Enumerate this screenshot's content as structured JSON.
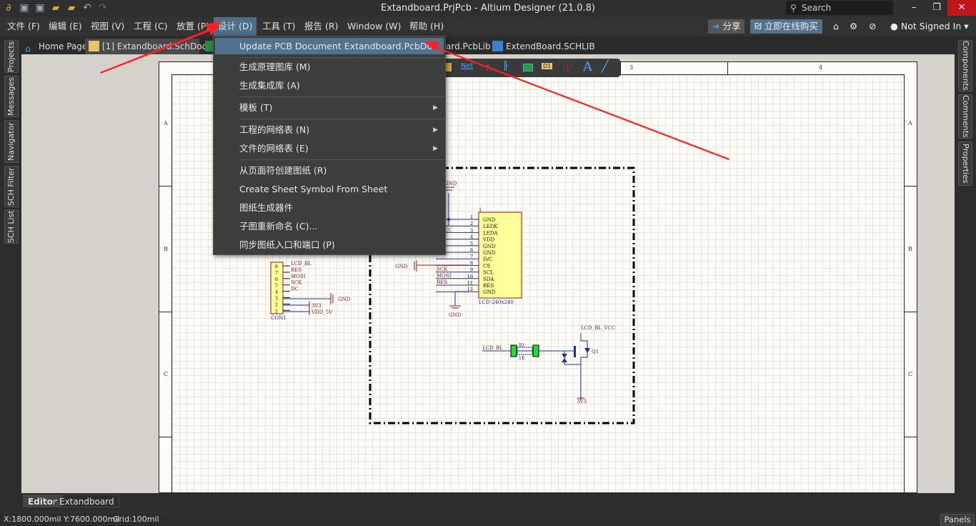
{
  "window": {
    "title": "Extandboard.PrjPcb - Altium Designer (21.0.8)",
    "search_placeholder": "Search",
    "minimize": "–",
    "restore": "❐",
    "close": "✕"
  },
  "menubar": {
    "items": [
      "文件 (F)",
      "编辑 (E)",
      "视图 (V)",
      "工程 (C)",
      "放置 (P)",
      "设计 (D)",
      "工具 (T)",
      "报告 (R)",
      "Window (W)",
      "帮助 (H)"
    ],
    "active": "设计 (D)",
    "share": "分享",
    "buy": "立即在线购买",
    "user": "Not Signed In"
  },
  "tabs": [
    {
      "label": "Home Page"
    },
    {
      "label": "[1] Extandboard.SchDoc *"
    },
    {
      "label": "ard.PcbLib"
    },
    {
      "label": "ExtendBoard.SCHLIB"
    }
  ],
  "left_panels": [
    "Projects",
    "Messages",
    "Navigator",
    "SCH Filter",
    "SCH List"
  ],
  "right_panels": [
    "Components",
    "Comments",
    "Properties"
  ],
  "dropdown": {
    "items": [
      {
        "label": "Update PCB Document Extandboard.PcbDoc",
        "highlighted": true
      },
      {
        "label": "生成原理图库 (M)"
      },
      {
        "label": "生成集成库 (A)"
      },
      {
        "label": "模板 (T)",
        "submenu": true
      },
      {
        "label": "工程的网络表 (N)",
        "submenu": true
      },
      {
        "label": "文件的网络表 (E)",
        "submenu": true
      },
      {
        "label": "从页面符创建图纸 (R)"
      },
      {
        "label": "Create Sheet Symbol From Sheet"
      },
      {
        "label": "图纸生成器件"
      },
      {
        "label": "子图重新命名 (C)..."
      },
      {
        "label": "同步图纸入口和端口 (P)"
      }
    ]
  },
  "active_bar": {
    "net_label": "Net",
    "port_label": "D1",
    "text_label": "A"
  },
  "sheet": {
    "columns": [
      "3",
      "4"
    ],
    "rows": [
      "A",
      "B",
      "C"
    ]
  },
  "schematic": {
    "lcd": {
      "designator": "1",
      "name": "LCD-240x240",
      "pins": [
        [
          "1",
          "GND"
        ],
        [
          "2",
          "LEDK"
        ],
        [
          "3",
          "LEDA"
        ],
        [
          "4",
          "VDD"
        ],
        [
          "5",
          "GND"
        ],
        [
          "6",
          "GND"
        ],
        [
          "7",
          "D/C"
        ],
        [
          "8",
          "CS"
        ],
        [
          "9",
          "SCL"
        ],
        [
          "10",
          "SDA"
        ],
        [
          "11",
          "RES"
        ],
        [
          "12",
          "GND"
        ]
      ],
      "nets": {
        "gnd_top": "GND",
        "vcc": "CC",
        "gnd_left": "GND",
        "sck": "SCK",
        "mosi": "MOSI",
        "res": "RES",
        "gnd_bottom": "GND"
      }
    },
    "con": {
      "name": "CON1",
      "pins": [
        [
          "8",
          "LCD_BL"
        ],
        [
          "7",
          "RES"
        ],
        [
          "6",
          "MOSI"
        ],
        [
          "5",
          "SCK"
        ],
        [
          "4",
          "DC"
        ],
        [
          "3",
          ""
        ],
        [
          "2",
          ""
        ],
        [
          "1",
          ""
        ]
      ],
      "gnd": "GND",
      "v3": "3V3",
      "v5": "VDD_5V"
    },
    "backlight": {
      "net_in": "LCD_BL",
      "r": "R1",
      "rval": "1K",
      "q": "Q1",
      "vcc": "LCD_BL_VCC",
      "v3": "3V3"
    }
  },
  "bottom_tabs": [
    "Editor",
    "Extandboard"
  ],
  "status": {
    "coords": "X:1800.000mil Y:7600.000mil",
    "grid": "Grid:100mil",
    "panels": "Panels"
  },
  "colors": {
    "accent": "#52718c",
    "close": "#c0171c",
    "arrow": "#ff2020",
    "wire": "#1c2ea0",
    "part": "#8b1a1a",
    "body": "#ffff99"
  }
}
